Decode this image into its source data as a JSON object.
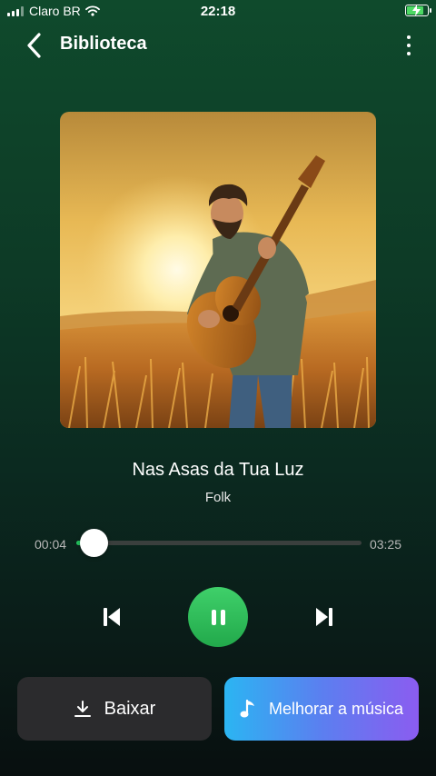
{
  "status_bar": {
    "carrier": "Claro BR",
    "time": "22:18",
    "battery_charging": true
  },
  "header": {
    "title": "Biblioteca",
    "back_icon": "chevron-left-icon",
    "menu_icon": "more-vertical-icon"
  },
  "track": {
    "title": "Nas Asas da Tua Luz",
    "genre": "Folk",
    "current_time": "00:04",
    "total_time": "03:25",
    "progress_fraction": 0.06
  },
  "controls": {
    "previous_icon": "skip-previous-icon",
    "play_pause_icon": "pause-icon",
    "next_icon": "skip-next-icon",
    "state": "playing"
  },
  "actions": {
    "download_label": "Baixar",
    "enhance_label": "Melhorar a música"
  },
  "colors": {
    "accent_green": "#22c55e",
    "enhance_gradient_start": "#2bb5f2",
    "enhance_gradient_end": "#8b5cf0"
  }
}
